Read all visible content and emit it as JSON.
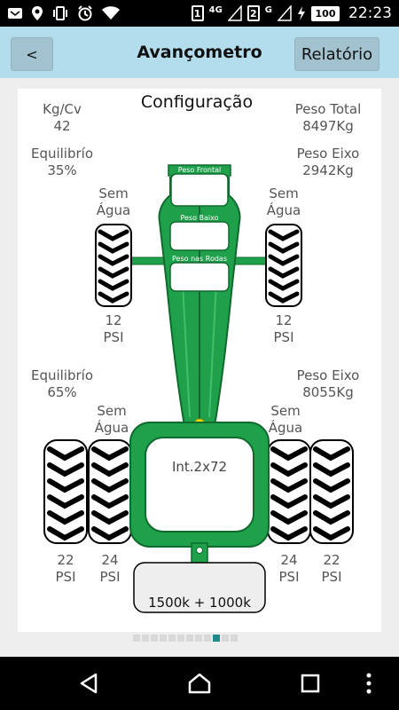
{
  "status_bar": {
    "sim1": "1",
    "sim1_network": "4G",
    "sim2": "2",
    "sim2_network": "G",
    "battery": "100",
    "time": "22:23"
  },
  "header": {
    "back_label": "<",
    "title": "Avançometro",
    "report_label": "Relatório"
  },
  "card": {
    "title": "Configuração",
    "kg_cv_label": "Kg/Cv",
    "kg_cv_value": "42",
    "total_weight_label": "Peso Total",
    "total_weight_value": "8497Kg",
    "front_balance_label": "Equilibrío",
    "front_balance_value": "35%",
    "front_axle_label": "Peso Eixo",
    "front_axle_value": "2942Kg",
    "rear_balance_label": "Equilibrío",
    "rear_balance_value": "65%",
    "rear_axle_label": "Peso Eixo",
    "rear_axle_value": "8055Kg",
    "front_left_ballast": [
      "Sem",
      "Água"
    ],
    "front_right_ballast": [
      "Sem",
      "Água"
    ],
    "rear_left_ballast": [
      "Sem",
      "Água"
    ],
    "rear_right_ballast": [
      "Sem",
      "Água"
    ],
    "front_left_pressure": [
      "12",
      "PSI"
    ],
    "front_right_pressure": [
      "12",
      "PSI"
    ],
    "rear_outer_left_pressure": [
      "22",
      "PSI"
    ],
    "rear_inner_left_pressure": [
      "24",
      "PSI"
    ],
    "rear_inner_right_pressure": [
      "24",
      "PSI"
    ],
    "rear_outer_right_pressure": [
      "22",
      "PSI"
    ],
    "front_weight_label": "Peso Frontal",
    "lower_weight_label": "Peso Baixo",
    "wheel_weight_label": "Peso nas Rodas",
    "cab_label": "Int.2x72",
    "hitch_weight": "1500k + 1000k"
  },
  "pager": {
    "count": 12,
    "active_index": 9
  },
  "colors": {
    "tractor_green": "#1fa04a",
    "app_bar": "#b3dcec",
    "pager_active": "#1f8a8a"
  }
}
